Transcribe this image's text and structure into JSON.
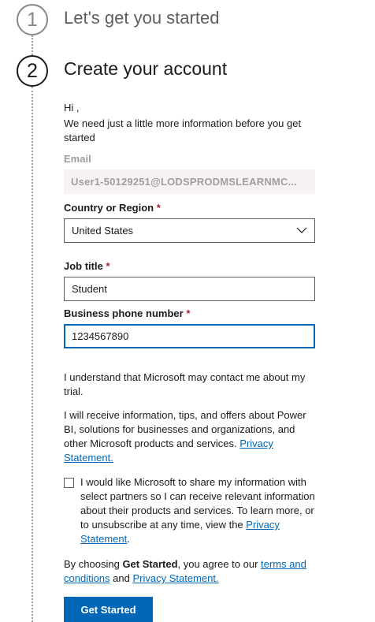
{
  "steps": [
    {
      "number": "1",
      "title": "Let's get you started"
    },
    {
      "number": "2",
      "title": "Create your account"
    }
  ],
  "form": {
    "greeting": "Hi ,",
    "intro": "We need just a little more information before you get started",
    "email": {
      "label": "Email",
      "value": "User1-50129251@LODSPRODMSLEARNMC..."
    },
    "country": {
      "label": "Country or Region",
      "required_mark": "*",
      "value": "United States"
    },
    "job_title": {
      "label": "Job title",
      "required_mark": "*",
      "value": "Student"
    },
    "phone": {
      "label": "Business phone number",
      "required_mark": "*",
      "value": "1234567890"
    },
    "contact_notice": "I understand that Microsoft may contact me about my trial.",
    "info_notice": "I will receive information, tips, and offers about Power BI, solutions for businesses and organizations, and other Microsoft products and services.",
    "privacy_link": "Privacy Statement.",
    "partner_share": {
      "checked": false,
      "text": "I would like Microsoft to share my information with select partners so I can receive relevant information about their products and services. To learn more, or to unsubscribe at any time, view the",
      "privacy_link": "Privacy Statement",
      "suffix": "."
    },
    "agreement": {
      "prefix": "By choosing ",
      "bold": "Get Started",
      "middle": ", you agree to our ",
      "terms_link": "terms and conditions",
      "and": " and ",
      "privacy_link": "Privacy Statement."
    },
    "submit_label": "Get Started"
  },
  "icons": {
    "select_chevron": "chevron-down-icon"
  },
  "colors": {
    "accent": "#0067b8",
    "required": "#a4262c",
    "disabled_text": "#a19f9d",
    "readonly_bg": "#f7f1f2"
  }
}
